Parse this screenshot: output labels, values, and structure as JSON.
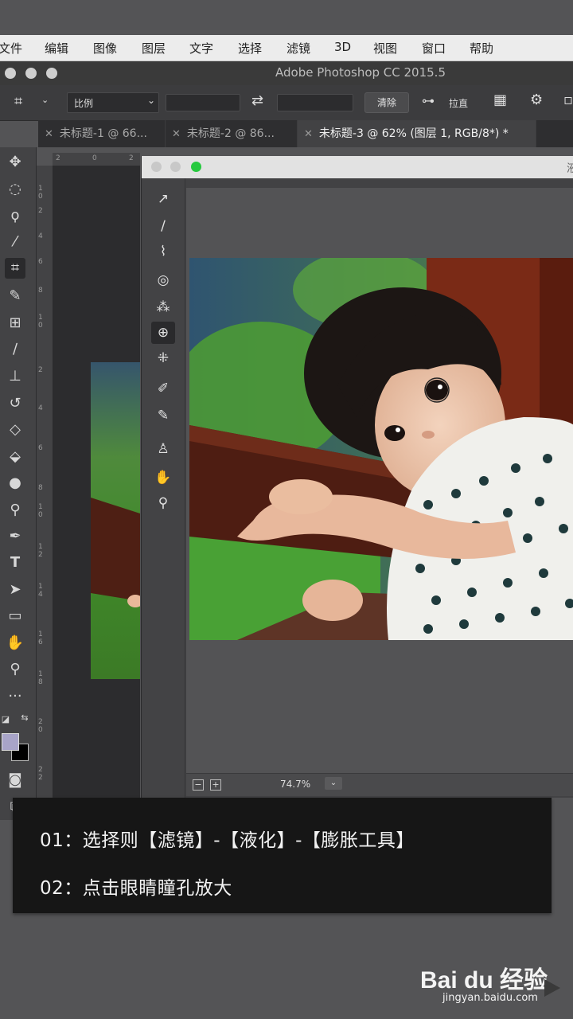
{
  "menu": [
    "文件",
    "编辑",
    "图像",
    "图层",
    "文字",
    "选择",
    "滤镜",
    "3D",
    "视图",
    "窗口",
    "帮助"
  ],
  "app_title": "Adobe Photoshop CC 2015.5",
  "options": {
    "crop_preset": "比例",
    "clear_button": "清除",
    "straighten_label": "拉直"
  },
  "tabs": [
    {
      "label": "未标题-1 @ 66...",
      "active": false
    },
    {
      "label": "未标题-2 @ 86...",
      "active": false
    },
    {
      "label": "未标题-3 @ 62% (图层 1, RGB/8*) *",
      "active": true
    }
  ],
  "ruler": {
    "h": [
      "2",
      "0",
      "2"
    ],
    "v": [
      "1",
      "0",
      "2",
      "4",
      "6",
      "8",
      "1",
      "0",
      "2",
      "4",
      "6",
      "8",
      "1",
      "0",
      "1",
      "2",
      "1",
      "4",
      "1",
      "6",
      "1",
      "8",
      "2",
      "0",
      "2",
      "2"
    ]
  },
  "liquify": {
    "title_partial": "液",
    "zoom": "74.7%",
    "zoom_dropdown": "⌄"
  },
  "caption": {
    "line1": "01：选择则【滤镜】-【液化】-【膨胀工具】",
    "line2": "02：点击眼睛瞳孔放大"
  },
  "watermark": {
    "brand": "Bai du 经验",
    "url": "jingyan.baidu.com"
  },
  "colors": {
    "foreground": "#a8a4c8",
    "background": "#000000",
    "workspace": "#545456",
    "panel": "#434345"
  },
  "icons": {
    "tools": [
      "move-icon",
      "marquee-icon",
      "lasso-icon",
      "magic-wand-icon",
      "crop-icon",
      "eyedropper-icon",
      "healing-brush-icon",
      "brush-icon",
      "stamp-icon",
      "history-brush-icon",
      "eraser-icon",
      "paint-bucket-icon",
      "blur-icon",
      "dodge-icon",
      "pen-icon",
      "type-icon",
      "path-select-icon",
      "rectangle-icon",
      "hand-icon",
      "zoom-icon",
      "more-icon"
    ],
    "liquify_tools": [
      "forward-warp-icon",
      "reconstruct-icon",
      "smooth-icon",
      "twirl-icon",
      "pucker-icon",
      "bloat-icon",
      "push-left-icon",
      "freeze-mask-icon",
      "thaw-mask-icon",
      "face-tool-icon",
      "hand-icon",
      "zoom-icon"
    ]
  }
}
